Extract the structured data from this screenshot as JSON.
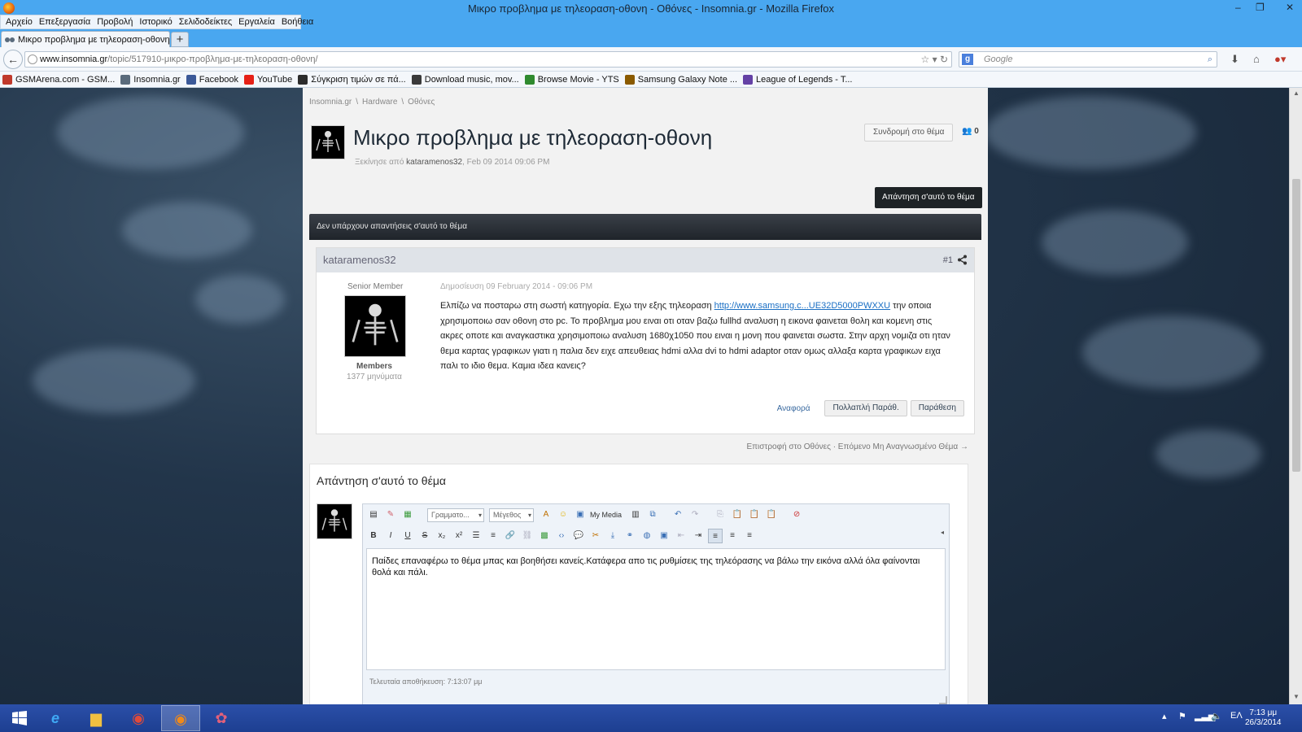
{
  "window": {
    "title": "Μικρο προβλημα με τηλεοραση-οθονη - Οθόνες - Insomnia.gr - Mozilla Firefox",
    "controls": [
      "–",
      "❐",
      "✕"
    ]
  },
  "menu": [
    "Αρχείο",
    "Επεξεργασία",
    "Προβολή",
    "Ιστορικό",
    "Σελιδοδείκτες",
    "Εργαλεία",
    "Βοήθεια"
  ],
  "tab": {
    "label": "Μικρο προβλημα με τηλεοραση-οθονη ...",
    "new_tab": "+"
  },
  "nav": {
    "back": "←",
    "url_host": "www.insomnia.gr",
    "url_path": "/topic/517910-μικρο-προβλημα-με-τηλεοραση-οθονη/",
    "search_placeholder": "Google",
    "search_engine_glyph": "g"
  },
  "bookmarks": [
    {
      "label": "GSMArena.com - GSM...",
      "color": "#c0392b"
    },
    {
      "label": "Insomnia.gr",
      "color": "#5a6b7c"
    },
    {
      "label": "Facebook",
      "color": "#3b5998"
    },
    {
      "label": "YouTube",
      "color": "#e62117"
    },
    {
      "label": "Σύγκριση τιμών σε πά...",
      "color": "#2c2c2c"
    },
    {
      "label": "Download music, mov...",
      "color": "#3a3a3a"
    },
    {
      "label": "Browse Movie - YTS",
      "color": "#2f8a2f"
    },
    {
      "label": "Samsung Galaxy Note ...",
      "color": "#8a5a00"
    },
    {
      "label": "League of Legends - T...",
      "color": "#6441a5"
    }
  ],
  "breadcrumb": [
    "Insomnia.gr",
    "Hardware",
    "Οθόνες"
  ],
  "breadcrumb_sep": "\\",
  "topic": {
    "title": "Μικρο προβλημα με τηλεοραση-οθονη",
    "started_by_label": "Ξεκίνησε από",
    "author": "kataramenos32",
    "date": ", Feb 09 2014 09:06 PM",
    "follow_label": "Συνδρομή στο θέμα",
    "followers": "0",
    "reply_button": "Απάντηση σ'αυτό το θέμα",
    "no_replies": "Δεν υπάρχουν απαντήσεις σ'αυτό το θέμα"
  },
  "post": {
    "author": "kataramenos32",
    "number": "#1",
    "rank": "Senior Member",
    "group": "Members",
    "post_count": "1377 μηνύματα",
    "date": "Δημοσίευση 09 February 2014 - 09:06 PM",
    "body_before_link": "Ελπίζω να ποσταρω στη σωστή κατηγορία. Εχω την εξης τηλεοραση ",
    "link_text": "http://www.samsung.c...UE32D5000PWXXU",
    "body_after_link": " την οποια χρησιμοποιω σαν οθονη στο pc. Το προβλημα μου ειναι οτι οταν βαζω fullhd αναλυση η εικονα φαινεται θολη και κομενη στις ακρες οποτε και αναγκαστικα χρησιμοποιω αναλυση 1680χ1050 που ειναι η μονη που φαινεται σωστα. Στην αρχη νομιζα οτι ηταν θεμα καρτας γραφικων γιατι η παλια δεν ειχε απευθειας hdmi αλλα dvi to hdmi adaptor οταν ομως αλλαξα καρτα γραφικων ειχα παλι το ιδιο θεμα. Καμια ιδεα κανεις?",
    "report": "Αναφορά",
    "multiquote": "Πολλαπλή Παράθ.",
    "quote": "Παράθεση"
  },
  "return_links": "Επιστροφή στο Οθόνες · Επόμενο Μη Αναγνωσμένο Θέμα →",
  "reply": {
    "title": "Απάντηση σ'αυτό το θέμα",
    "font_select": "Γραμματο...",
    "size_select": "Μέγεθος",
    "my_media": "My Media",
    "text": "Παίδες επαναφέρω το θέμα μπας και βοηθήσει κανείς.Κατάφερα απο τις ρυθμίσεις της τηλεόρασης να βάλω την εικόνα αλλά όλα φαίνονται θολά και πάλι.",
    "autosave": "Τελευταία αποθήκευση: 7:13:07 μμ"
  },
  "taskbar": {
    "lang": "ΕΛ",
    "time": "7:13 μμ",
    "date": "26/3/2014"
  },
  "colors": {
    "accent": "#49a7f0",
    "link": "#1a6fc4",
    "dark_button": "#1e2326",
    "taskbar": "#1d3f91"
  }
}
